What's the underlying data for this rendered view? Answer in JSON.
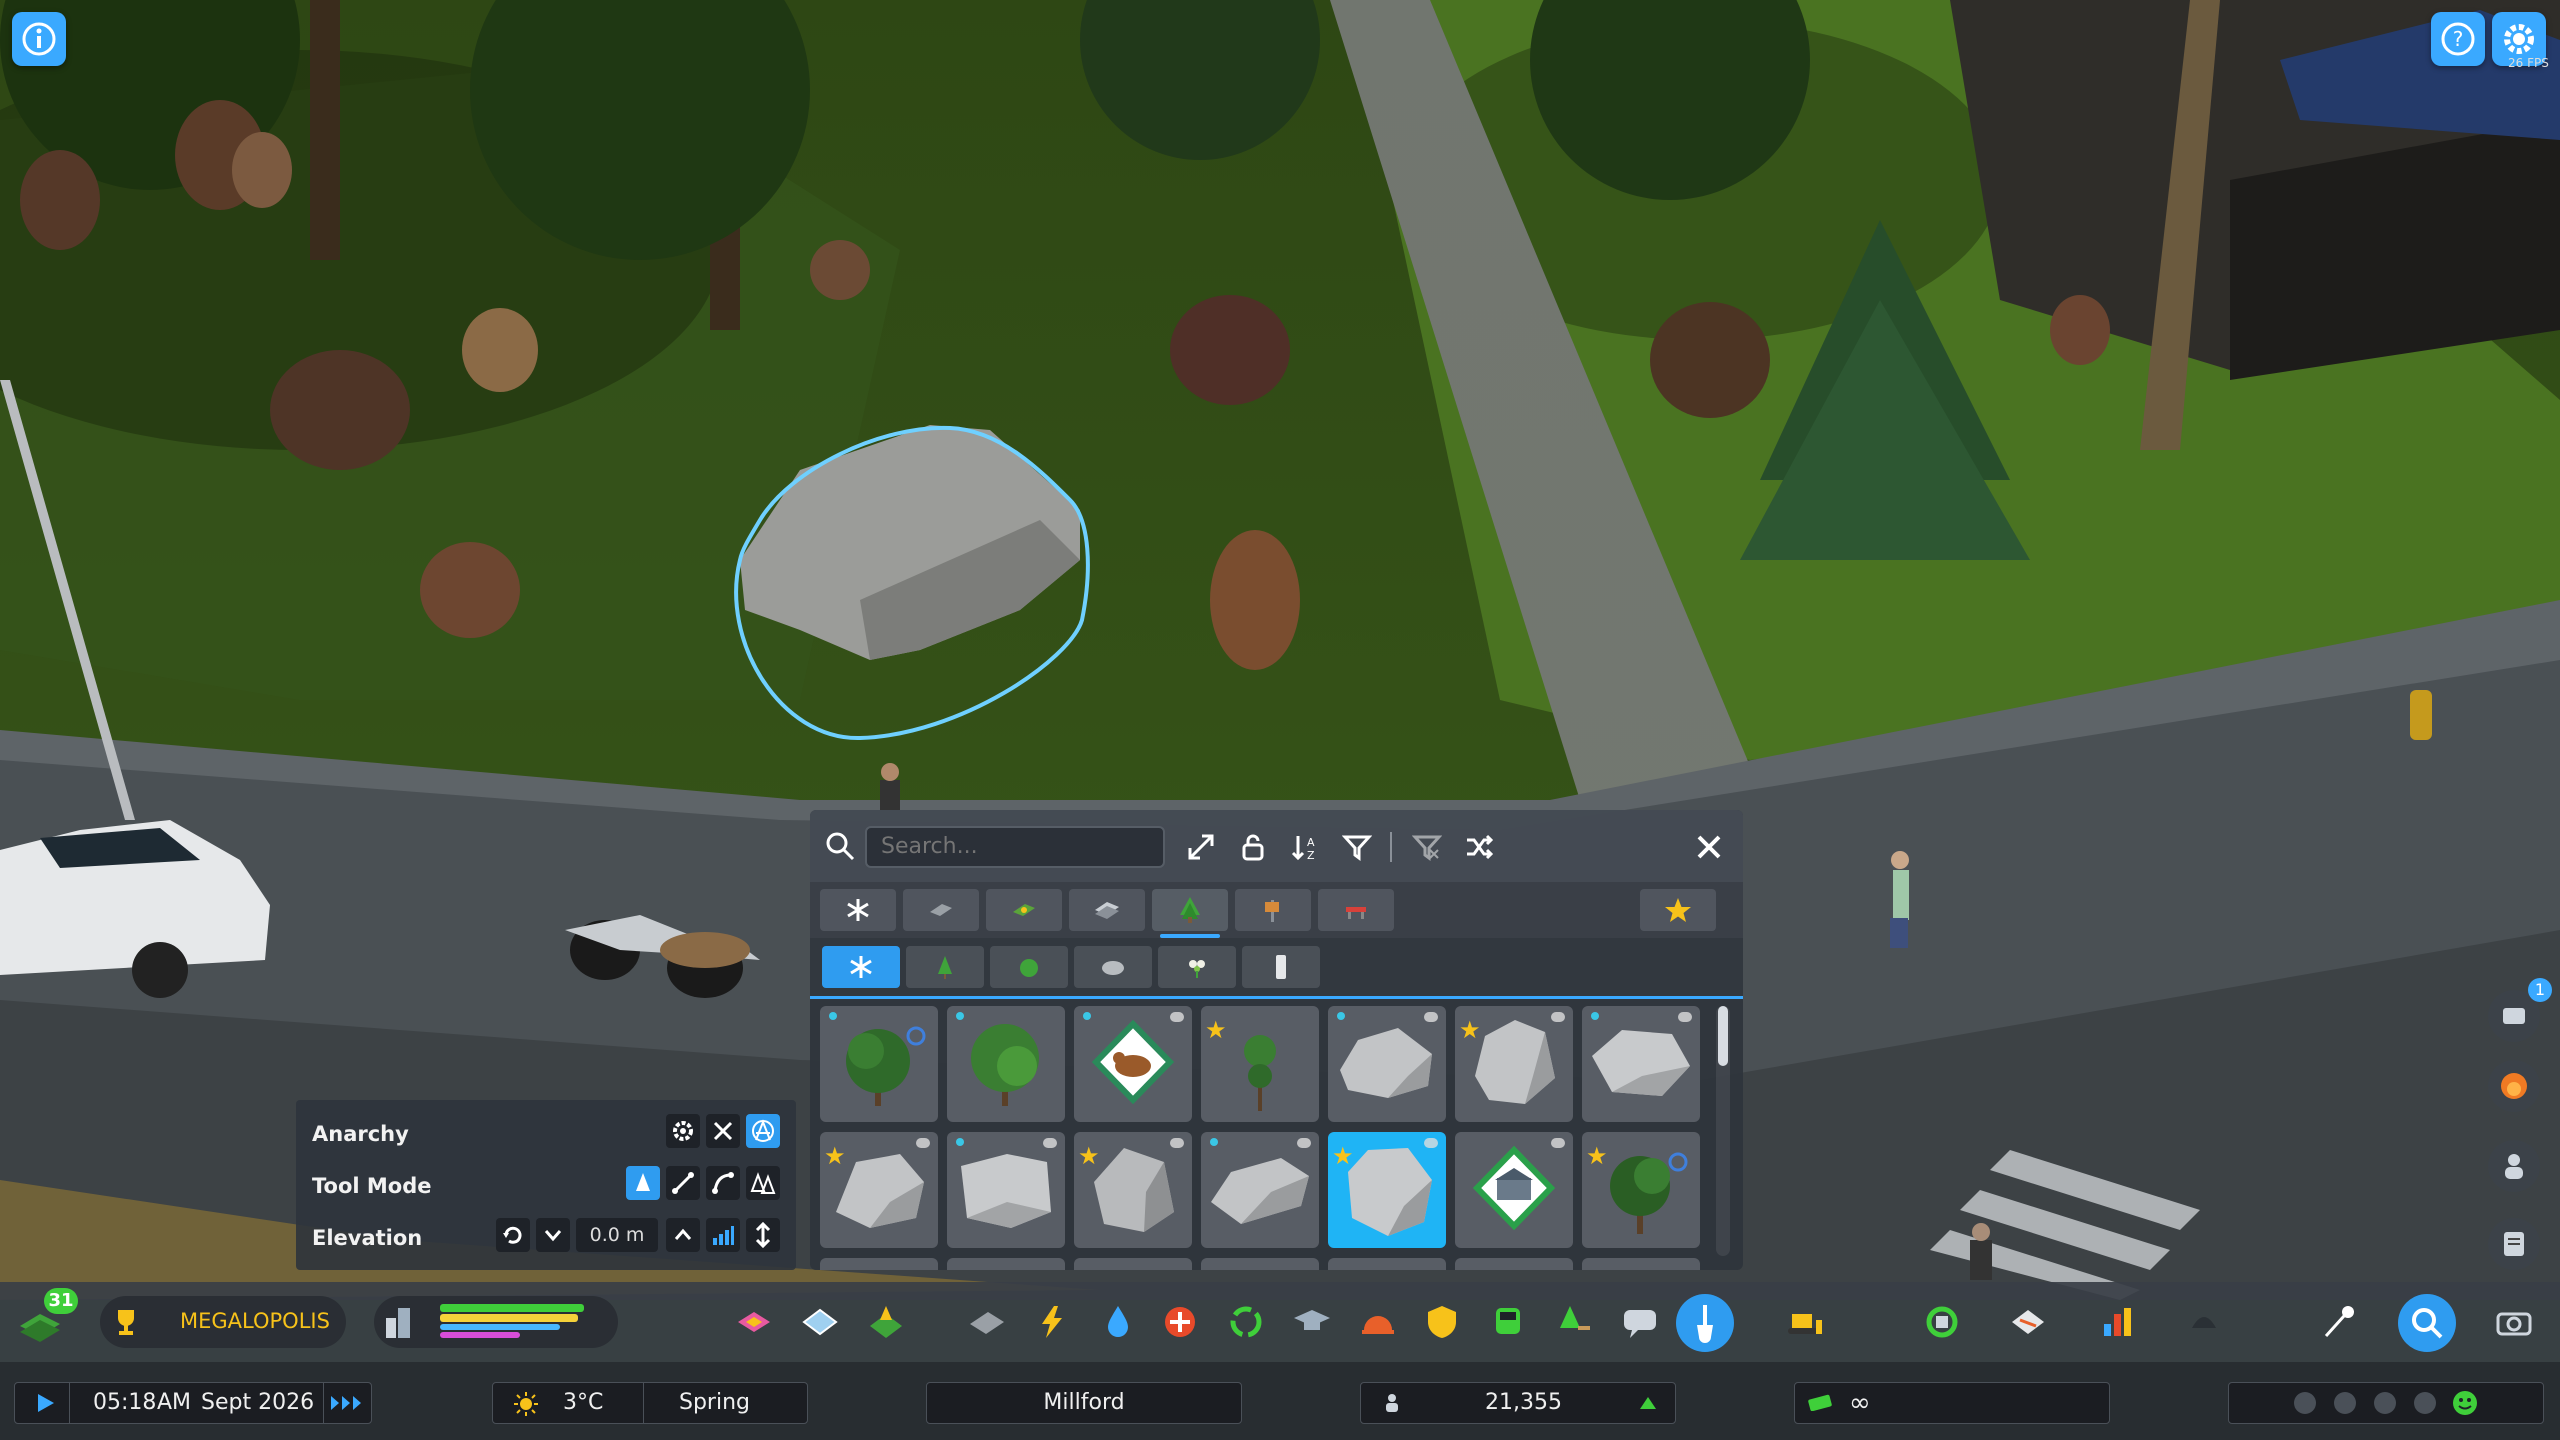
{
  "hud": {
    "info_icon": "info-icon",
    "help_icon": "help-icon",
    "settings_icon": "gear-icon",
    "settings_sub": "26 FPS"
  },
  "asset_panel": {
    "search_placeholder": "Search...",
    "toolbar_icons": [
      "expand-icon",
      "lock-icon",
      "sort-icon",
      "filter-icon",
      "clear-filter-icon",
      "shuffle-icon"
    ],
    "close_icon": "close-icon",
    "category_tabs": [
      "all",
      "paths",
      "surfaces",
      "decals",
      "vegetation",
      "props",
      "furniture"
    ],
    "favorites_tab": "favorites-star",
    "active_category": "vegetation",
    "sub_tabs": [
      "all",
      "trees",
      "bushes",
      "rocks",
      "flowers",
      "misc"
    ],
    "active_sub_tab": "all"
  },
  "tool_options": {
    "anarchy_label": "Anarchy",
    "tool_mode_label": "Tool Mode",
    "elevation_label": "Elevation",
    "elevation_value": "0.0 m"
  },
  "bottom_bar": {
    "level_badge": "31",
    "milestone_label": "MEGALOPOLIS",
    "progress_bars": [
      {
        "color": "#3fcf3a",
        "fill": 0.9
      },
      {
        "color": "#f5d23a",
        "fill": 0.86
      },
      {
        "color": "#47b7ff",
        "fill": 0.75
      },
      {
        "color": "#d84dd8",
        "fill": 0.5
      }
    ]
  },
  "status_bar": {
    "time": "05:18",
    "ampm": "AM",
    "date": "Sept 2026",
    "temperature": "3°C",
    "season": "Spring",
    "city_name": "Millford",
    "population": "21,355",
    "money": "∞"
  },
  "side_badge": "1",
  "colors": {
    "accent": "#3aa9ff",
    "grass": "#3d5f1c",
    "road": "#444a4e"
  }
}
